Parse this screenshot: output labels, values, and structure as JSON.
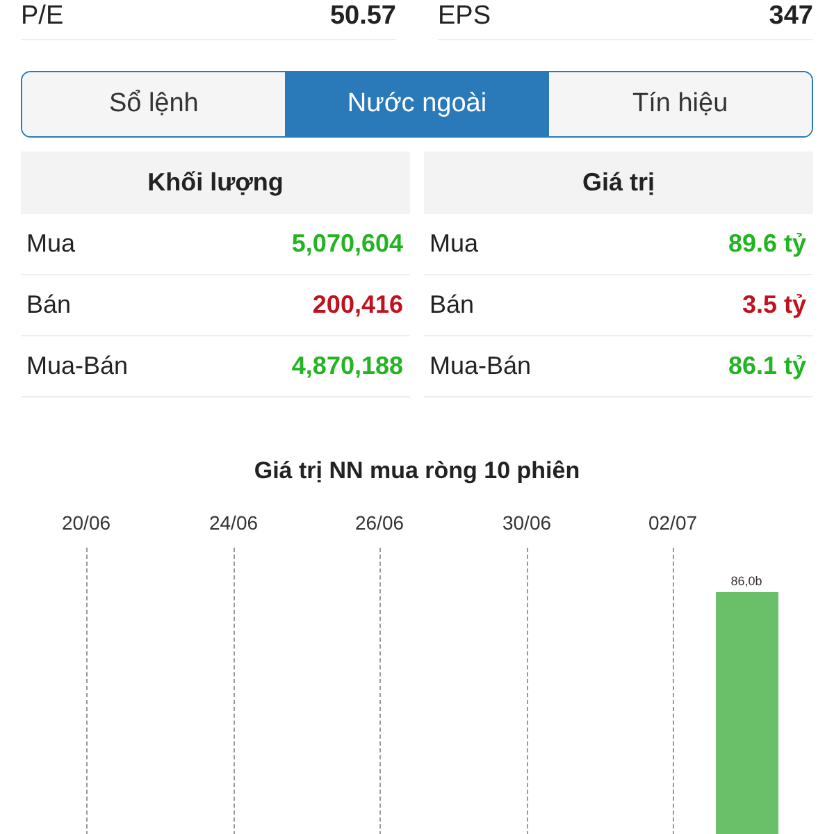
{
  "ratios": [
    {
      "label": "P/E",
      "value": "50.57"
    },
    {
      "label": "EPS",
      "value": "347"
    }
  ],
  "tabs": [
    {
      "label": "Sổ lệnh",
      "selected": false
    },
    {
      "label": "Nước ngoài",
      "selected": true
    },
    {
      "label": "Tín hiệu",
      "selected": false
    }
  ],
  "tables": [
    {
      "heading": "Khối lượng",
      "rows": [
        {
          "label": "Mua",
          "value": "5,070,604",
          "color": "#22b422"
        },
        {
          "label": "Bán",
          "value": "200,416",
          "color": "#c0111f"
        },
        {
          "label": "Mua-Bán",
          "value": "4,870,188",
          "color": "#22b422"
        }
      ]
    },
    {
      "heading": "Giá trị",
      "rows": [
        {
          "label": "Mua",
          "value": "89.6 tỷ",
          "color": "#22b422"
        },
        {
          "label": "Bán",
          "value": "3.5 tỷ",
          "color": "#c0111f"
        },
        {
          "label": "Mua-Bán",
          "value": "86.1 tỷ",
          "color": "#22b422"
        }
      ]
    }
  ],
  "chart": {
    "title": "Giá trị NN mua ròng 10 phiên",
    "date_labels": [
      "20/06",
      "24/06",
      "26/06",
      "30/06",
      "02/07"
    ],
    "bar_label": "86,0b"
  }
}
